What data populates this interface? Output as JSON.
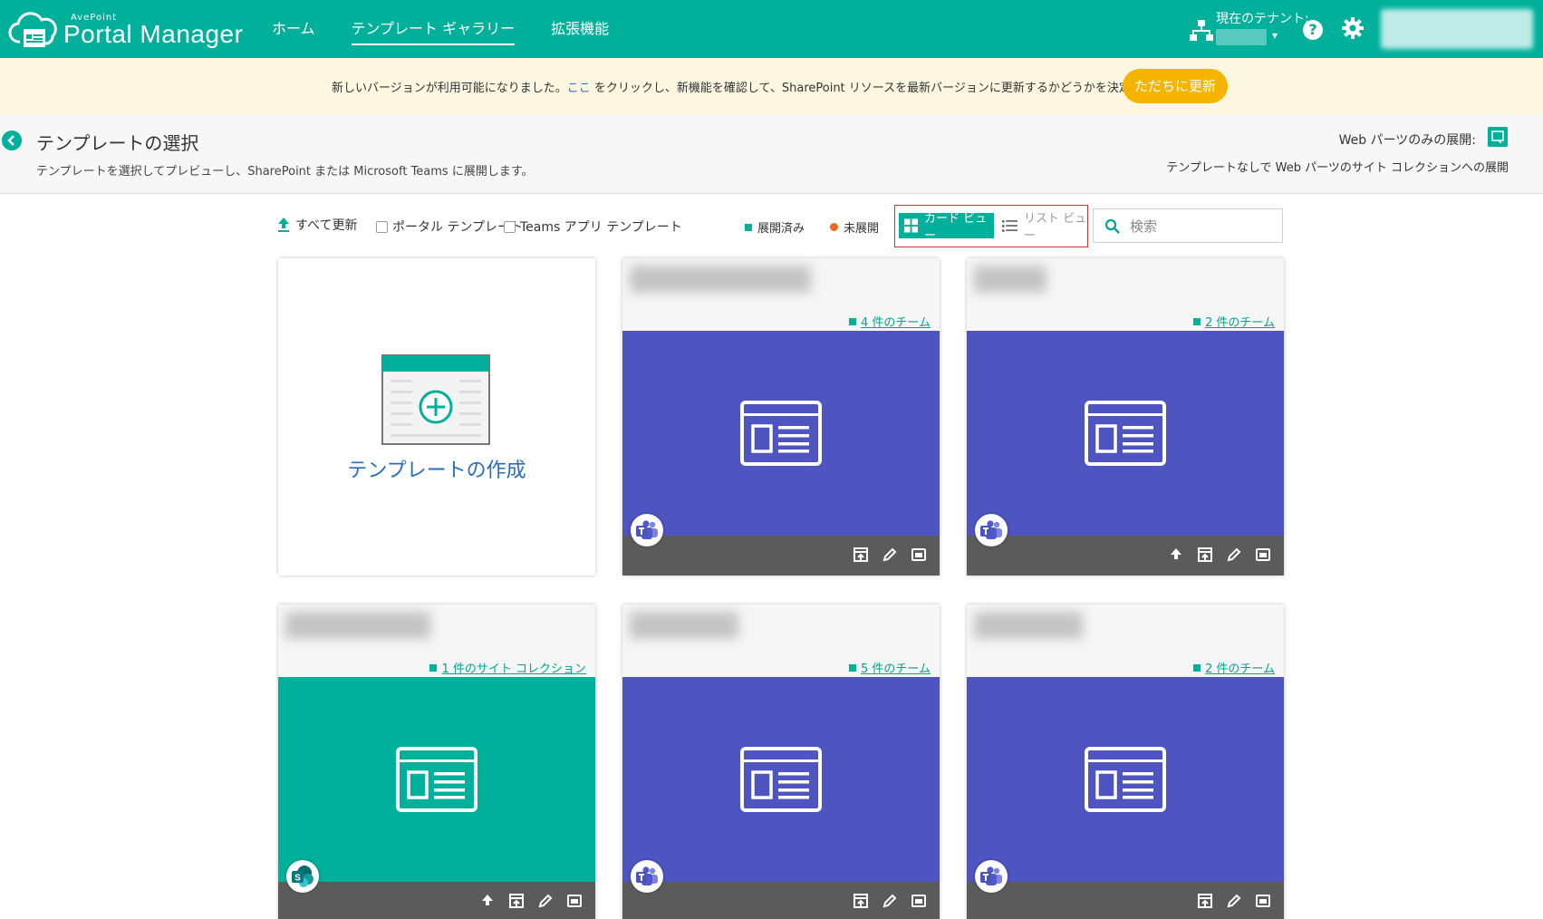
{
  "header": {
    "logo_small": "AvePoint",
    "logo_big": "Portal Manager",
    "nav": [
      {
        "label": "ホーム"
      },
      {
        "label": "テンプレート ギャラリー"
      },
      {
        "label": "拡張機能"
      }
    ],
    "tenant_label": "現在のテナント:",
    "help": "?"
  },
  "notice": {
    "text_before": "新しいバージョンが利用可能になりました。",
    "link": "ここ",
    "text_after": " をクリックし、新機能を確認して、SharePoint リソースを最新バージョンに更新するかどうかを決定してください。",
    "button": "ただちに更新"
  },
  "title_area": {
    "title": "テンプレートの選択",
    "subtitle": "テンプレートを選択してプレビューし、SharePoint または Microsoft Teams に展開します。",
    "webparts_label": "Web パーツのみの展開:",
    "webparts_desc": "テンプレートなしで Web パーツのサイト コレクションへの展開"
  },
  "toolbar": {
    "refresh_all": "すべて更新",
    "portal_template": "ポータル テンプレート",
    "teams_template": "Teams アプリ テンプレート",
    "deployed": "展開済み",
    "undeployed": "未展開",
    "card_view": "カード ビュー",
    "list_view": "リスト ビュー",
    "search_placeholder": "検索"
  },
  "cards": {
    "create_label": "テンプレートの作成",
    "items": [
      {
        "count": "4 件のチーム",
        "type": "teams"
      },
      {
        "count": "2 件のチーム",
        "type": "teams"
      },
      {
        "count": "1 件のサイト コレクション",
        "type": "sharepoint"
      },
      {
        "count": "5 件のチーム",
        "type": "teams"
      },
      {
        "count": "2 件のチーム",
        "type": "teams"
      }
    ]
  },
  "colors": {
    "brand": "#00b09b",
    "teams": "#4e54c0",
    "update_button": "#f5b400",
    "undeployed": "#f26522"
  }
}
